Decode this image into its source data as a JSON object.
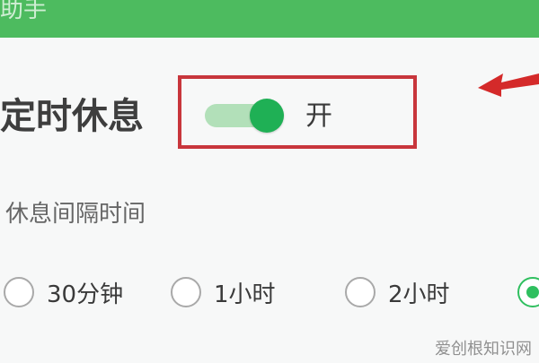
{
  "window": {
    "title_fragment": "助手",
    "titlebar_color": "#4dbb5f"
  },
  "timed_rest": {
    "title": "定时休息",
    "toggle": {
      "state_label": "开",
      "is_on": true,
      "on_color": "#1fb055",
      "track_color": "#b2e0b9"
    },
    "highlight_color": "#c8363c"
  },
  "interval": {
    "label": "休息间隔时间",
    "options": [
      {
        "label": "30分钟",
        "selected": false
      },
      {
        "label": "1小时",
        "selected": false
      },
      {
        "label": "2小时",
        "selected": false
      },
      {
        "label": "",
        "selected": true
      }
    ]
  },
  "annotation": {
    "arrow_icon": "red-arrow-icon",
    "arrow_color": "#d42a2a"
  },
  "watermark": "爱创根知识网"
}
